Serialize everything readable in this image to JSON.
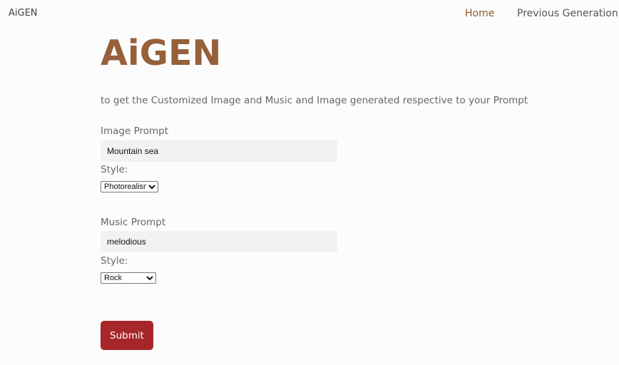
{
  "brand": "AiGEN",
  "nav": {
    "home": "Home",
    "previous": "Previous Generation"
  },
  "hero": {
    "title": "AiGEN",
    "subtitle": "to get the Customized Image and Music and Image generated respective to your Prompt"
  },
  "image_section": {
    "label": "Image Prompt",
    "value": "Mountain sea",
    "style_label": "Style:",
    "style_value": "Photorealism"
  },
  "music_section": {
    "label": "Music Prompt",
    "value": "melodious",
    "style_label": "Style:",
    "style_value": "Rock"
  },
  "submit_label": "Submit",
  "colors": {
    "brand_accent": "#95603a",
    "nav_active": "#8b5a2b",
    "submit_bg": "#a6262a",
    "input_bg": "#f2f2f2"
  }
}
